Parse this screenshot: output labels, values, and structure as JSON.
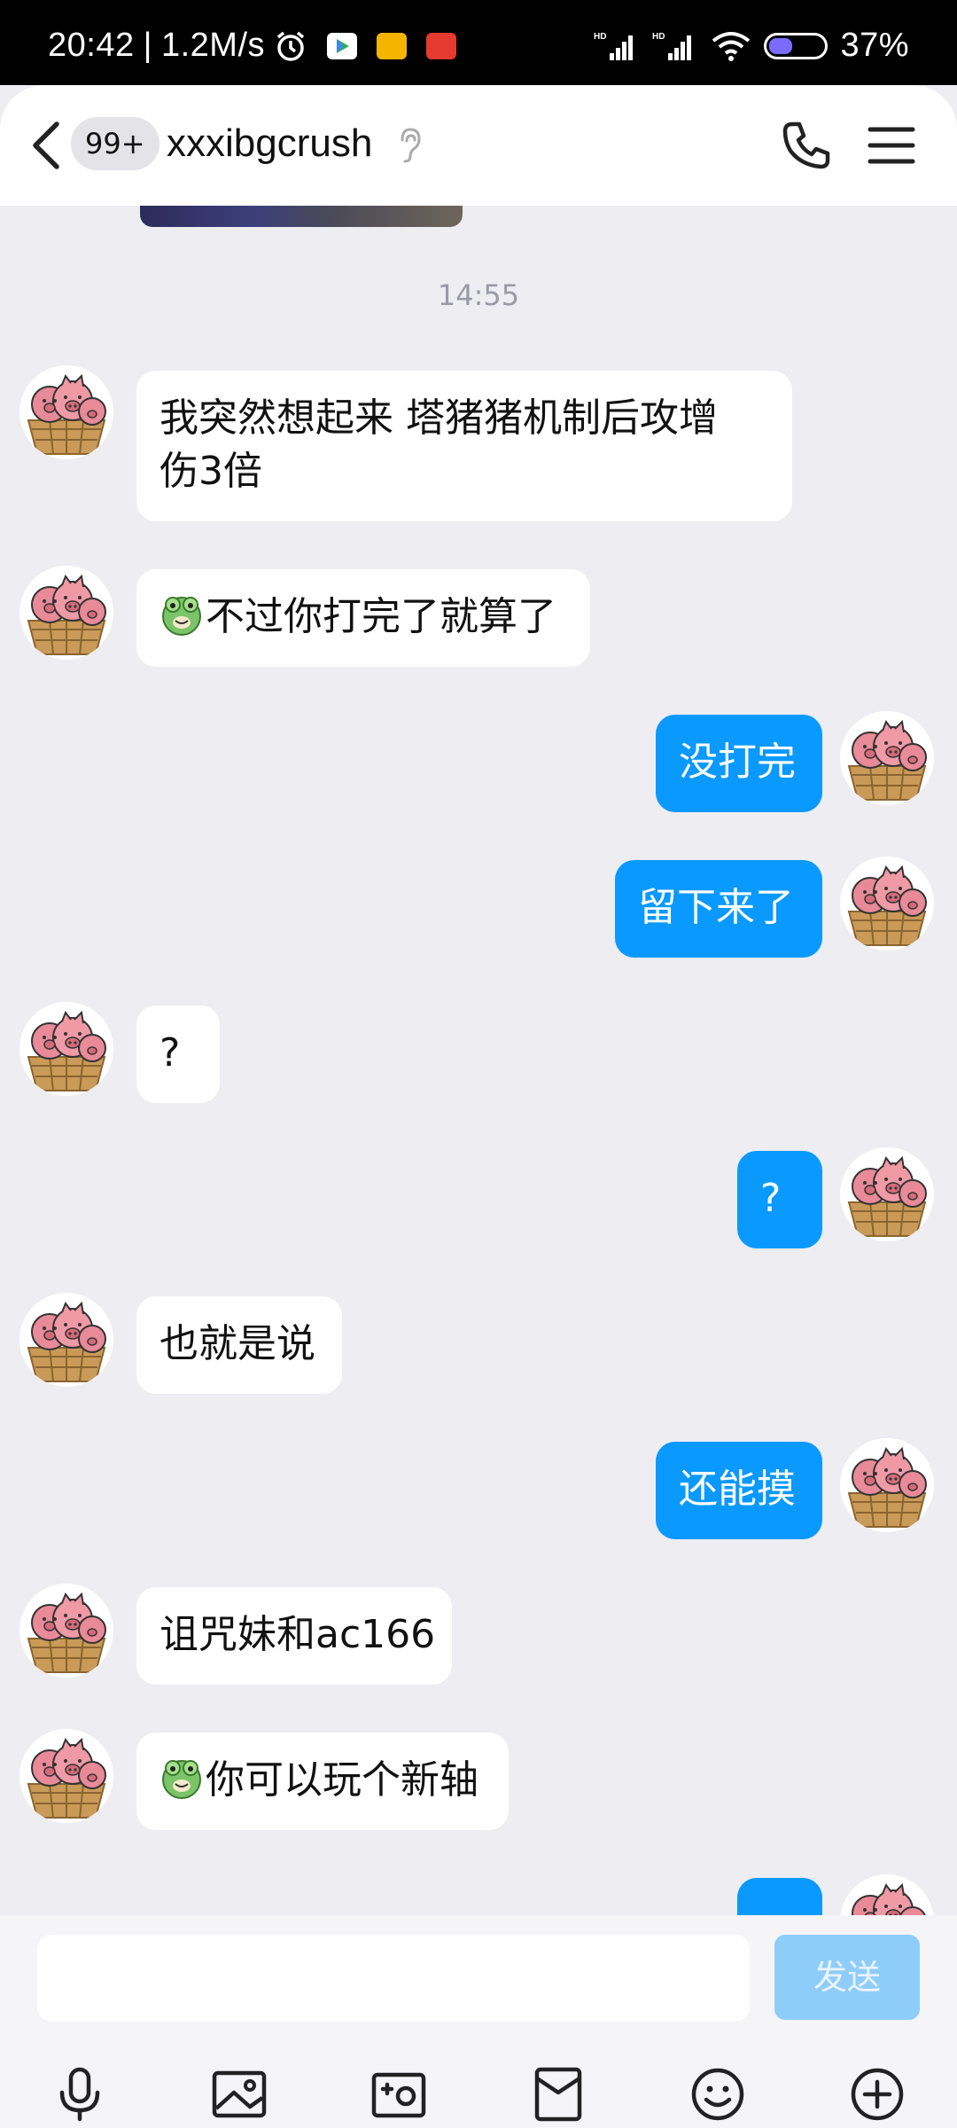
{
  "status_bar": {
    "time": "20:42",
    "speed": "1.2M/s",
    "battery": "37%"
  },
  "header": {
    "unread_badge": "99+",
    "contact_name": "xxxibgcrush"
  },
  "chat": {
    "timestamp": "14:55",
    "messages": [
      {
        "side": "incoming",
        "line1": "我突然想起来 塔猪猪机制后攻增",
        "line2": "伤3倍"
      },
      {
        "side": "incoming",
        "text": "不过你打完了就算了",
        "emoji": "frog-emoji-icon"
      },
      {
        "side": "outgoing",
        "text": "没打完"
      },
      {
        "side": "outgoing",
        "text": "留下来了"
      },
      {
        "side": "incoming",
        "text": "?"
      },
      {
        "side": "outgoing",
        "text": "?"
      },
      {
        "side": "incoming",
        "text": "也就是说"
      },
      {
        "side": "outgoing",
        "text": "还能摸"
      },
      {
        "side": "incoming",
        "text": "诅咒妹和ac166"
      },
      {
        "side": "incoming",
        "text": "你可以玩个新轴",
        "emoji": "frog-emoji-icon"
      },
      {
        "side": "outgoing",
        "text": ""
      }
    ]
  },
  "input": {
    "placeholder": "",
    "send_label": "发送"
  },
  "toolbar": {
    "icons": [
      "microphone-icon",
      "image-icon",
      "camera-icon",
      "red-packet-icon",
      "emoji-icon",
      "plus-icon"
    ]
  },
  "colors": {
    "background": "#ededf2",
    "outgoing_bubble": "#0a99ff",
    "incoming_bubble": "#ffffff",
    "send_button": "#8fcdf9",
    "status_bar": "#000000"
  }
}
